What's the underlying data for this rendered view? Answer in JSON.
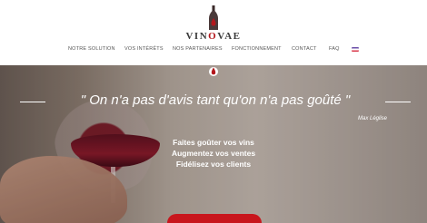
{
  "brand": {
    "name_prefix": "VIN",
    "name_accent": "O",
    "name_suffix": "VAE",
    "accent_color": "#b3161b"
  },
  "nav": {
    "items": [
      {
        "label": "NOTRE SOLUTION"
      },
      {
        "label": "VOS INTÉRÊTS"
      },
      {
        "label": "NOS PARTENAIRES"
      },
      {
        "label": "FONCTIONNEMENT"
      },
      {
        "label": "CONTACT"
      },
      {
        "label": "FAQ"
      }
    ],
    "language_flag": "french-flag-icon"
  },
  "hero": {
    "quote": "\" On n'a pas d'avis tant qu'on n'a pas goûté \"",
    "author": "Max Léglise",
    "benefits": [
      "Faites goûter vos vins",
      "Augmentez vos ventes",
      "Fidélisez vos clients"
    ],
    "cta_color": "#c8161d"
  }
}
